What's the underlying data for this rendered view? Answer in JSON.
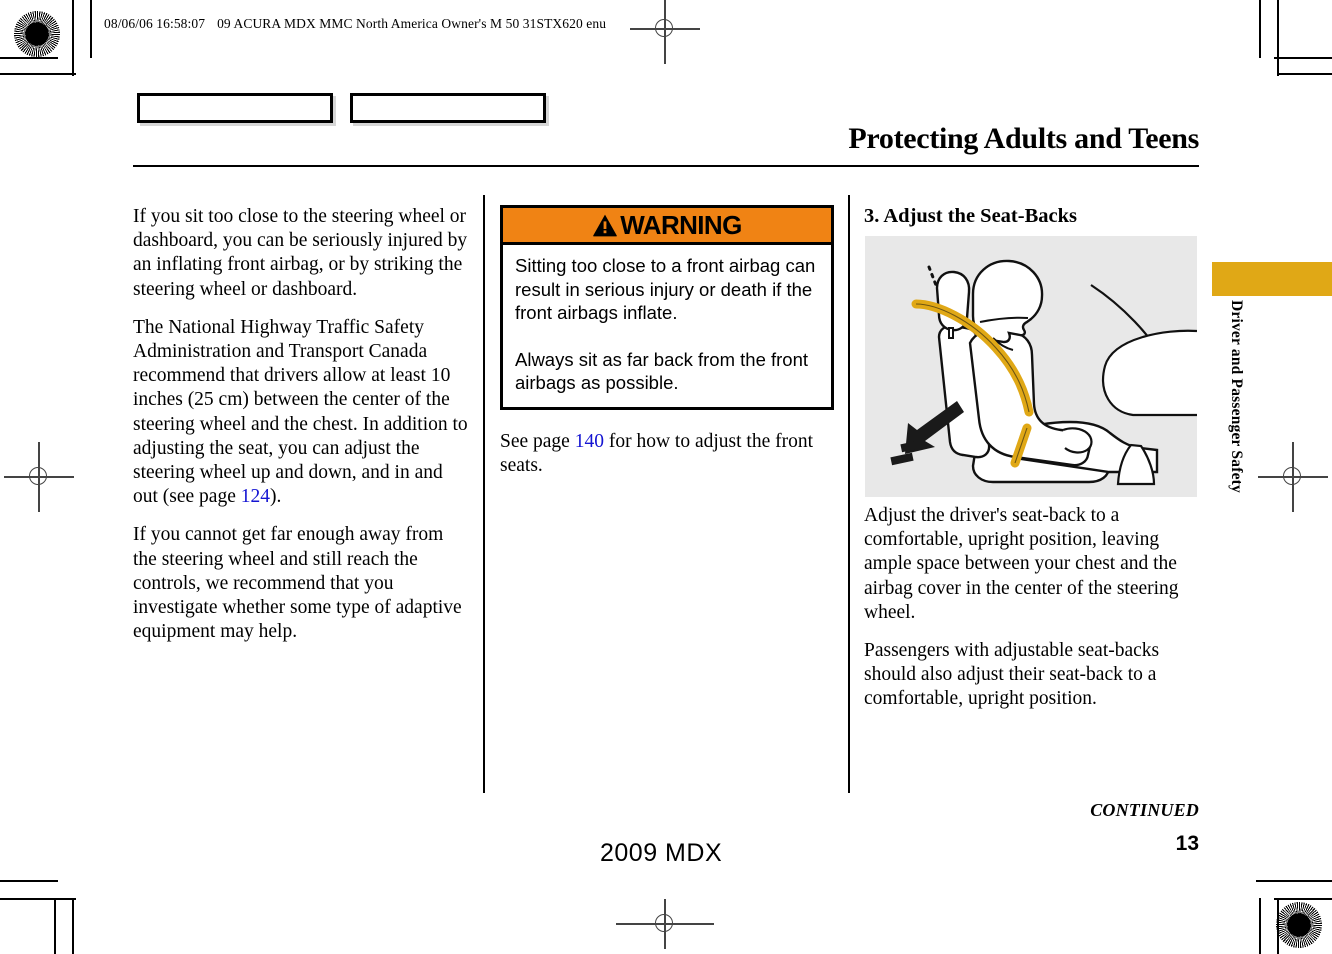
{
  "print_header": {
    "timestamp": "08/06/06 16:58:07",
    "job_id": "09 ACURA MDX MMC North America Owner's M 50 31STX620 enu"
  },
  "page_title": "Protecting Adults and Teens",
  "side_tab": {
    "label": "Driver and Passenger Safety",
    "color": "#e0a816"
  },
  "column_left": {
    "paragraphs": [
      "If you sit too close to the steering wheel or dashboard, you can be seriously injured by an inflating front airbag, or by striking the steering wheel or dashboard.",
      "The National Highway Traffic Safety Administration and Transport Canada recommend that drivers allow at least 10 inches (25 cm) between the center of the steering wheel and the chest. In addition to adjusting the seat, you can adjust the steering wheel up and down, and in and out (see page ",
      "If you cannot get far enough away from the steering wheel and still reach the controls, we recommend that you investigate whether some type of adaptive equipment may help."
    ],
    "page_ref": "124",
    "page_ref_tail": ")."
  },
  "warning": {
    "heading": "WARNING",
    "icon": "warning-triangle-icon",
    "header_color": "#f08314",
    "body_1": "Sitting too close to a front airbag can result in serious injury or death if the front airbags inflate.",
    "body_2": "Always sit as far back from the front airbags as possible."
  },
  "see_page": {
    "prefix": "See page ",
    "page_ref": "140",
    "suffix": " for how to adjust the front seats."
  },
  "column_right": {
    "heading": "3. Adjust the Seat-Backs",
    "figure": {
      "name": "seat-back-adjustment-illustration",
      "background": "#e8e8e8",
      "seatbelt_color": "#e0a816",
      "description": "Side view of occupant in a front seat with seat belt, black arrow pushing the seat-back upright and a dotted line showing the upright position"
    },
    "paragraphs": [
      "Adjust the driver's seat-back to a comfortable, upright position, leaving ample space between your chest and the airbag cover in the center of the steering wheel.",
      "Passengers with adjustable seat-backs should also adjust their seat-back to a comfortable, upright position."
    ]
  },
  "footer": {
    "continued": "CONTINUED",
    "model_year": "2009  MDX",
    "page_number": "13"
  }
}
